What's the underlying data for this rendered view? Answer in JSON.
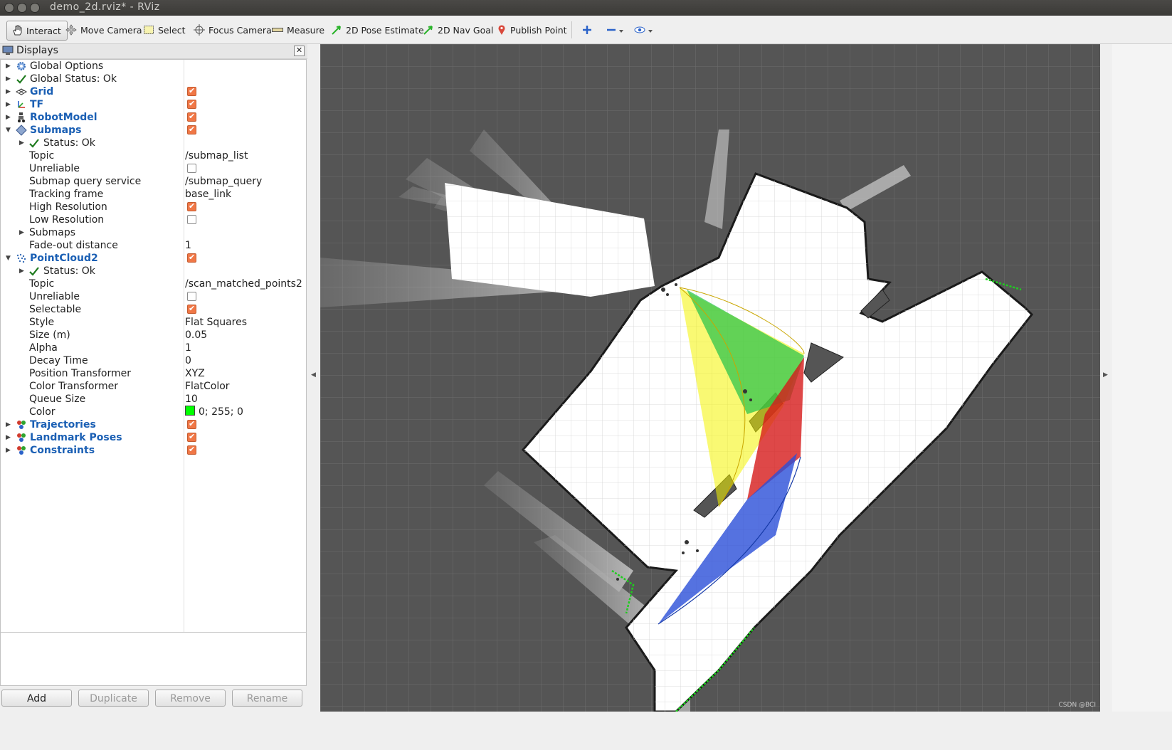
{
  "window": {
    "title": "demo_2d.rviz* - RViz"
  },
  "toolbar": {
    "tools": [
      {
        "label": "Interact",
        "icon": "hand-cursor-icon"
      },
      {
        "label": "Move Camera",
        "icon": "move-camera-icon"
      },
      {
        "label": "Select",
        "icon": "select-box-icon"
      },
      {
        "label": "Focus Camera",
        "icon": "crosshair-icon"
      },
      {
        "label": "Measure",
        "icon": "ruler-icon"
      },
      {
        "label": "2D Pose Estimate",
        "icon": "green-arrow-icon"
      },
      {
        "label": "2D Nav Goal",
        "icon": "green-arrow-icon"
      },
      {
        "label": "Publish Point",
        "icon": "map-pin-icon"
      }
    ],
    "extra_icons": [
      "plus-icon",
      "minus-icon",
      "eye-icon"
    ]
  },
  "displays": {
    "title": "Displays",
    "rows": [
      {
        "label": "Global Options",
        "icon": "gear-icon"
      },
      {
        "label": "Global Status: Ok",
        "icon": "check-icon"
      },
      {
        "label": "Grid",
        "icon": "grid-icon",
        "checked": true
      },
      {
        "label": "TF",
        "icon": "tf-axes-icon",
        "checked": true
      },
      {
        "label": "RobotModel",
        "icon": "robot-icon",
        "checked": true
      },
      {
        "label": "Submaps",
        "icon": "submap-icon",
        "checked": true
      },
      {
        "label": "Status: Ok",
        "icon": "check-icon"
      },
      {
        "label": "Topic",
        "value": "/submap_list"
      },
      {
        "label": "Unreliable",
        "checked": false
      },
      {
        "label": "Submap query service",
        "value": "/submap_query"
      },
      {
        "label": "Tracking frame",
        "value": "base_link"
      },
      {
        "label": "High Resolution",
        "checked": true
      },
      {
        "label": "Low Resolution",
        "checked": false
      },
      {
        "label": "Submaps"
      },
      {
        "label": "Fade-out distance",
        "value": "1"
      },
      {
        "label": "PointCloud2",
        "icon": "pointcloud-icon",
        "checked": true
      },
      {
        "label": "Status: Ok",
        "icon": "check-icon"
      },
      {
        "label": "Topic",
        "value": "/scan_matched_points2"
      },
      {
        "label": "Unreliable",
        "checked": false
      },
      {
        "label": "Selectable",
        "checked": true
      },
      {
        "label": "Style",
        "value": "Flat Squares"
      },
      {
        "label": "Size (m)",
        "value": "0.05"
      },
      {
        "label": "Alpha",
        "value": "1"
      },
      {
        "label": "Decay Time",
        "value": "0"
      },
      {
        "label": "Position Transformer",
        "value": "XYZ"
      },
      {
        "label": "Color Transformer",
        "value": "FlatColor"
      },
      {
        "label": "Queue Size",
        "value": "10"
      },
      {
        "label": "Color",
        "value": "0; 255; 0",
        "swatch": "#00ff00"
      },
      {
        "label": "Trajectories",
        "icon": "markers-icon",
        "checked": true
      },
      {
        "label": "Landmark Poses",
        "icon": "markers-icon",
        "checked": true
      },
      {
        "label": "Constraints",
        "icon": "markers-icon",
        "checked": true
      }
    ]
  },
  "buttons": {
    "add": "Add",
    "duplicate": "Duplicate",
    "remove": "Remove",
    "rename": "Rename"
  },
  "viewport": {
    "background": "#3a3a3a",
    "map_color": "#ffffff",
    "watermark": "CSDN @BCI"
  },
  "colors": {
    "accent_blue": "#1a5fb4",
    "checkbox": "#f07746",
    "pointcloud": "#00ff00"
  }
}
